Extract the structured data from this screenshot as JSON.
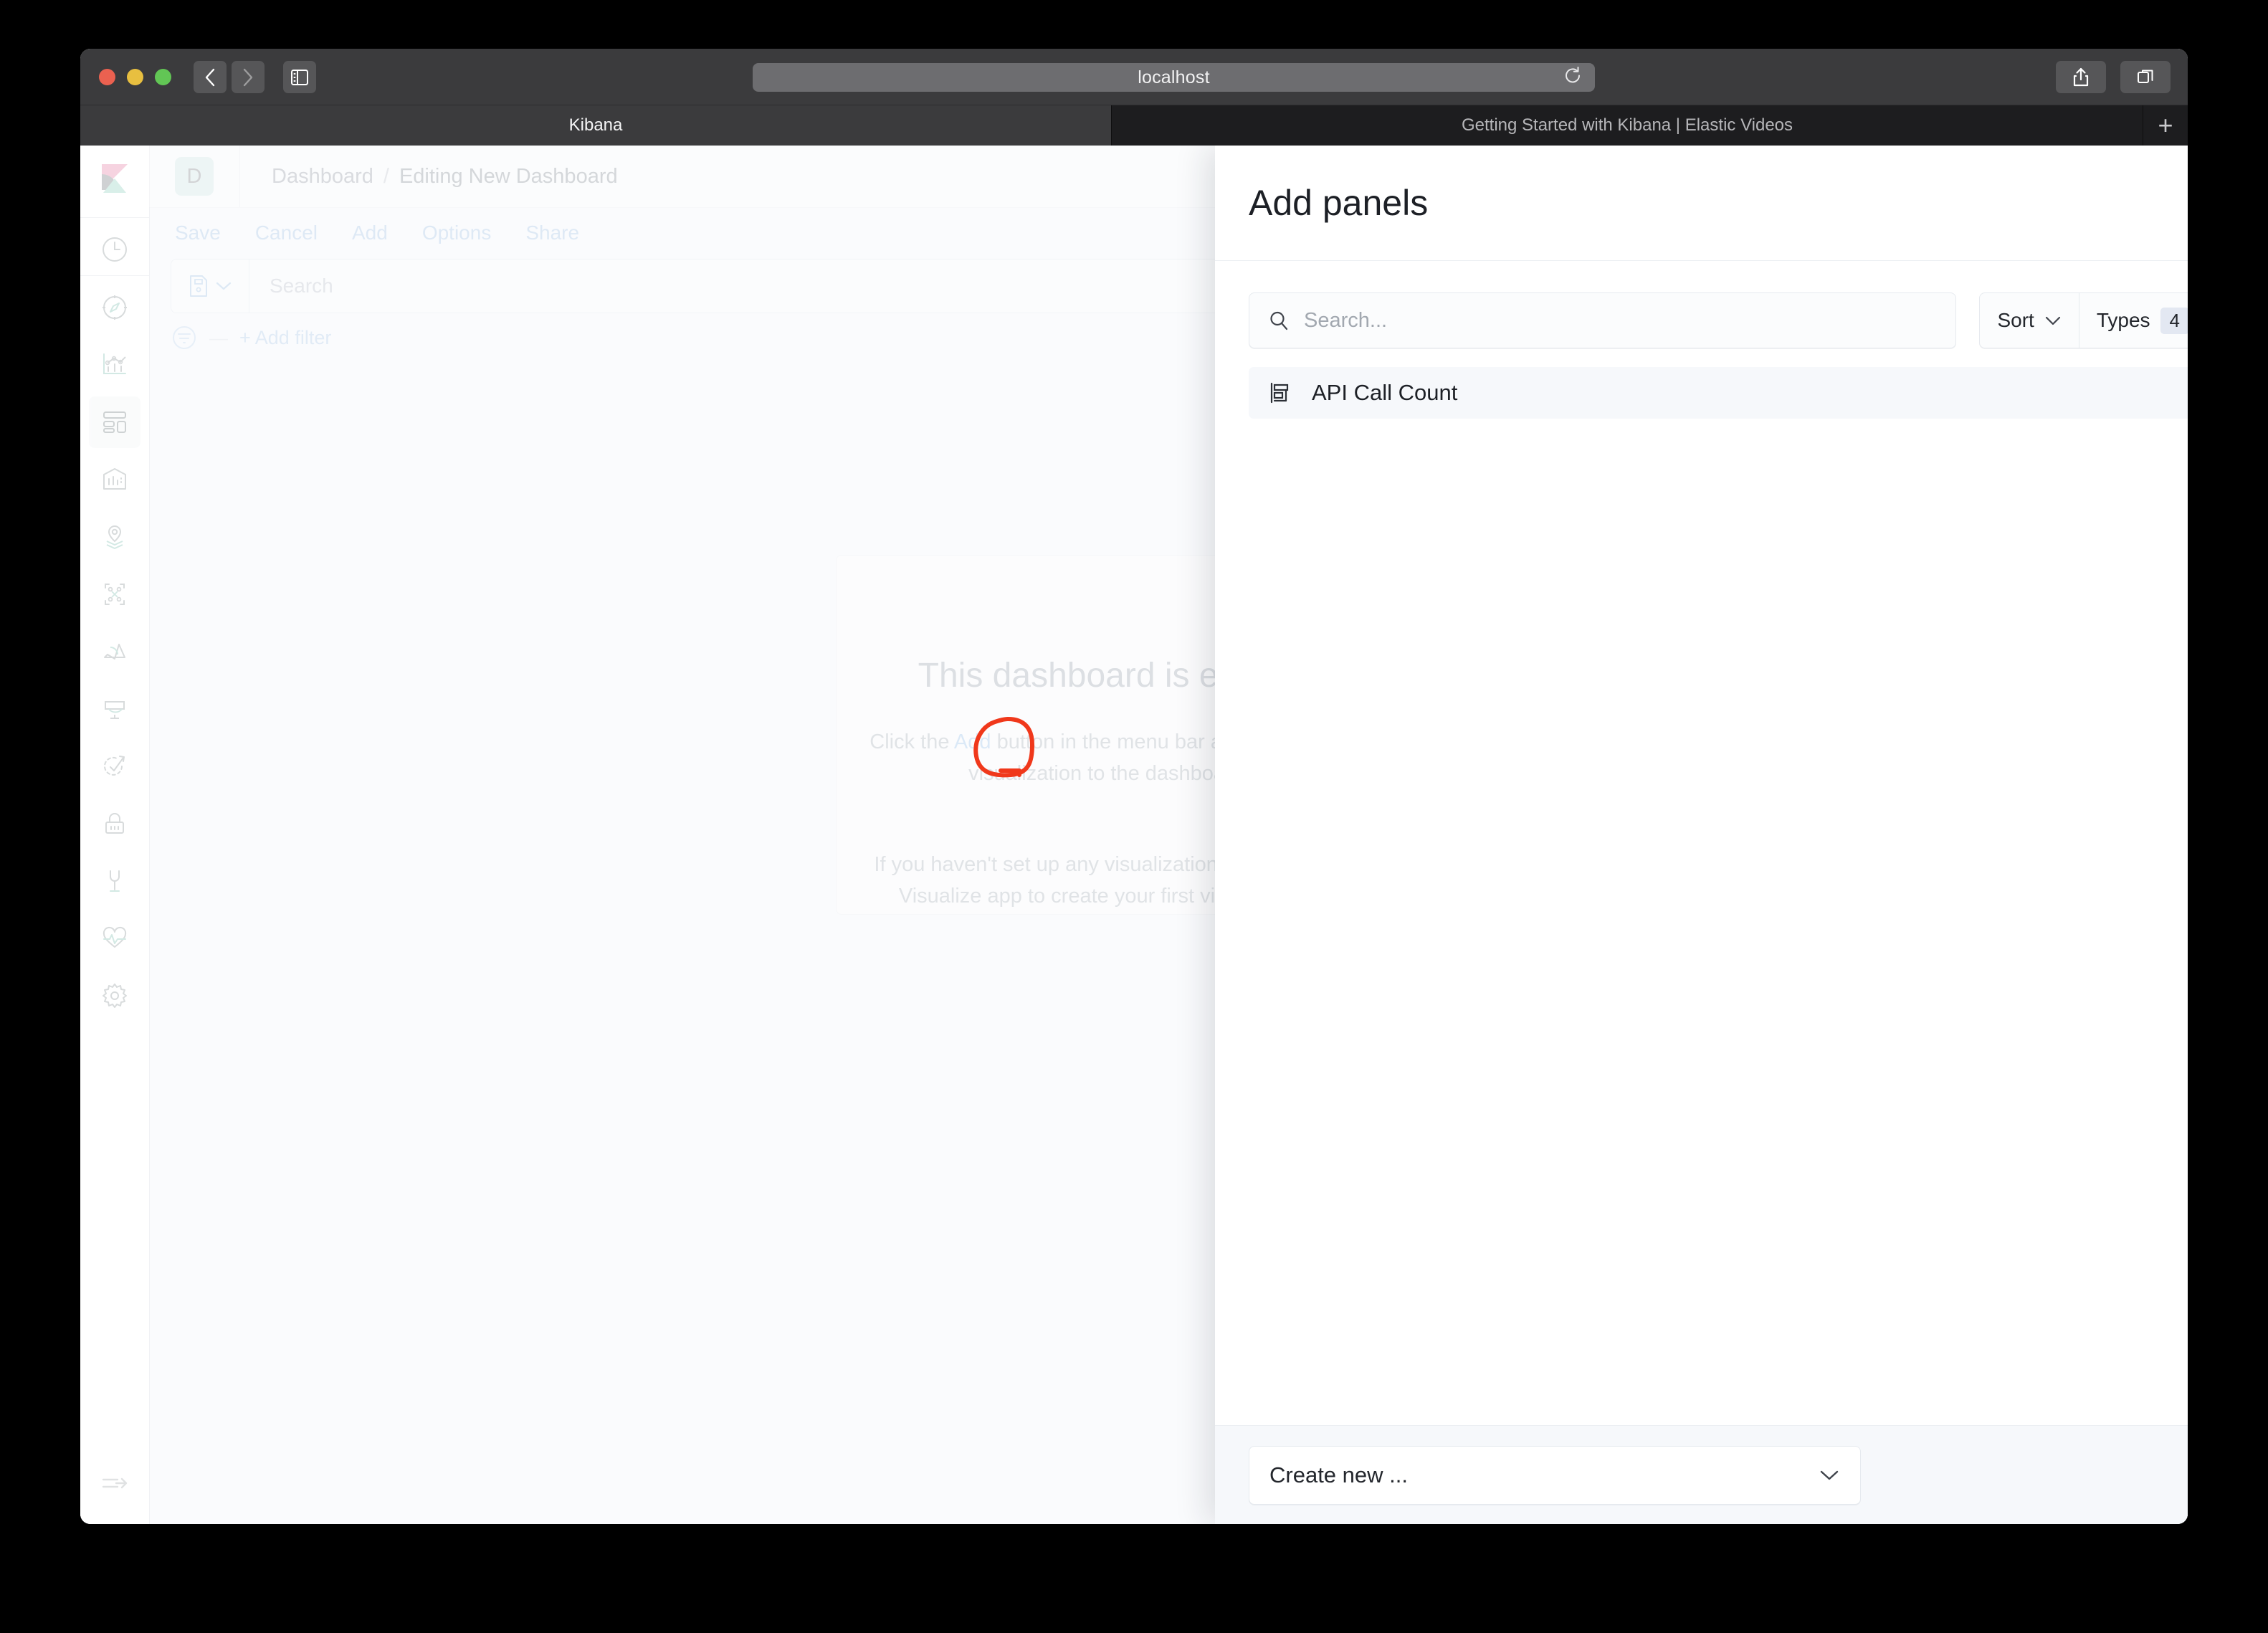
{
  "browser": {
    "url": "localhost",
    "traffic_lights": [
      "close",
      "minimize",
      "maximize"
    ],
    "back_label": "Back",
    "forward_label": "Forward",
    "sidebar_toggle_label": "Show sidebar",
    "reload_label": "Reload",
    "share_label": "Share",
    "tabs_overview_label": "Show tab overview",
    "new_tab_label": "+",
    "tabs": [
      {
        "title": "Kibana",
        "active": true
      },
      {
        "title": "Getting Started with Kibana | Elastic Videos",
        "active": false
      }
    ]
  },
  "kibana": {
    "logo_name": "elastic-kibana-logo",
    "space_badge": "D",
    "breadcrumb": {
      "root": "Dashboard",
      "separator": "/",
      "current": "Editing New Dashboard"
    },
    "top_menu": [
      "Save",
      "Cancel",
      "Add",
      "Options",
      "Share"
    ],
    "query_bar": {
      "dataview_icon": "saved-query-icon",
      "search_placeholder": "Search"
    },
    "filter_bar": {
      "filter_icon": "filter-icon",
      "dash": "—",
      "add_filter_label": "+ Add filter"
    },
    "empty_state": {
      "title": "This dashboard is empty.",
      "body_prefix": "Click the ",
      "body_link": "Add",
      "body_suffix": " button in the menu bar above to add a visualization to the dashboard.",
      "body2": "If you haven't set up any visualizations yet, visit the Visualize app to create your first visualization."
    },
    "annotation": {
      "shape": "hand-drawn-circle",
      "color": "#f0381b",
      "target": "Add"
    },
    "nav_rail": [
      {
        "icon": "recently-viewed-icon",
        "label": "Recently viewed",
        "selected": false
      },
      {
        "icon": "discover-compass-icon",
        "label": "Discover",
        "selected": false
      },
      {
        "icon": "visualize-chart-icon",
        "label": "Visualize",
        "selected": false
      },
      {
        "icon": "dashboard-icon",
        "label": "Dashboard",
        "selected": true
      },
      {
        "icon": "canvas-icon",
        "label": "Canvas",
        "selected": false
      },
      {
        "icon": "maps-icon",
        "label": "Maps",
        "selected": false
      },
      {
        "icon": "machine-learning-icon",
        "label": "Machine Learning",
        "selected": false
      },
      {
        "icon": "infrastructure-icon",
        "label": "Infrastructure",
        "selected": false
      },
      {
        "icon": "apm-icon",
        "label": "APM",
        "selected": false
      },
      {
        "icon": "logs-icon",
        "label": "Logs",
        "selected": false
      },
      {
        "icon": "uptime-icon",
        "label": "Uptime",
        "selected": false
      },
      {
        "icon": "security-lock-icon",
        "label": "SIEM",
        "selected": false
      },
      {
        "icon": "dev-tools-wrench-icon",
        "label": "Dev Tools",
        "selected": false
      },
      {
        "icon": "monitoring-heartbeat-icon",
        "label": "Stack Monitoring",
        "selected": false
      },
      {
        "icon": "management-gear-icon",
        "label": "Management",
        "selected": false
      }
    ],
    "nav_collapse": {
      "icon": "collapse-arrow-icon",
      "label": "Collapse"
    }
  },
  "flyout": {
    "title": "Add panels",
    "close_icon": "close-icon",
    "search": {
      "icon": "search-icon",
      "value": "",
      "placeholder": "Search..."
    },
    "sort": {
      "label": "Sort",
      "chevron": "chevron-down-icon"
    },
    "types": {
      "label": "Types",
      "count": "4",
      "chevron": "chevron-down-icon"
    },
    "items": [
      {
        "icon": "horizontal-bar-chart-icon",
        "label": "API Call Count"
      }
    ],
    "footer": {
      "create_new_label": "Create new ...",
      "chevron": "chevron-down-icon"
    }
  },
  "colors": {
    "accent_link": "#a9c8e8",
    "annotation_red": "#f0381b",
    "flyout_bg": "#ffffff",
    "toolbar_bg": "#3b3b3d",
    "tabbar_bg": "#1d1d1f",
    "badge_bg": "#d7ece7"
  }
}
